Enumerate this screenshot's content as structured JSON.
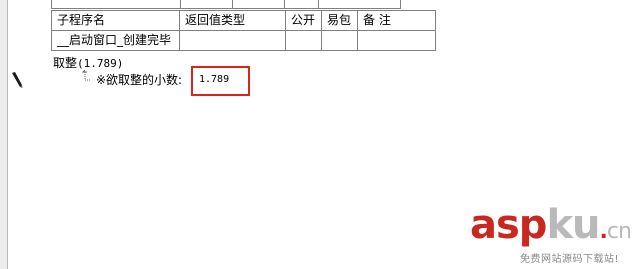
{
  "subroutine_table": {
    "headers": [
      "子程序名",
      "返回值类型",
      "公开",
      "易包",
      "备 注"
    ],
    "rows": [
      [
        "__启动窗口_创建完毕",
        "",
        "",
        "",
        ""
      ]
    ]
  },
  "code": {
    "function_name": "取整",
    "call_args": "(1.789)",
    "param_label": "※欲取整的小数:",
    "param_value": "1.789"
  },
  "watermark": {
    "asp": "asp",
    "ku": "ku",
    "dot": ".",
    "cn": "cn",
    "sub": "免费网站源码下载站!"
  },
  "colors": {
    "highlight_box": "#d9261c",
    "watermark_red": "#c8281e",
    "watermark_gray": "#b9b9b9"
  }
}
